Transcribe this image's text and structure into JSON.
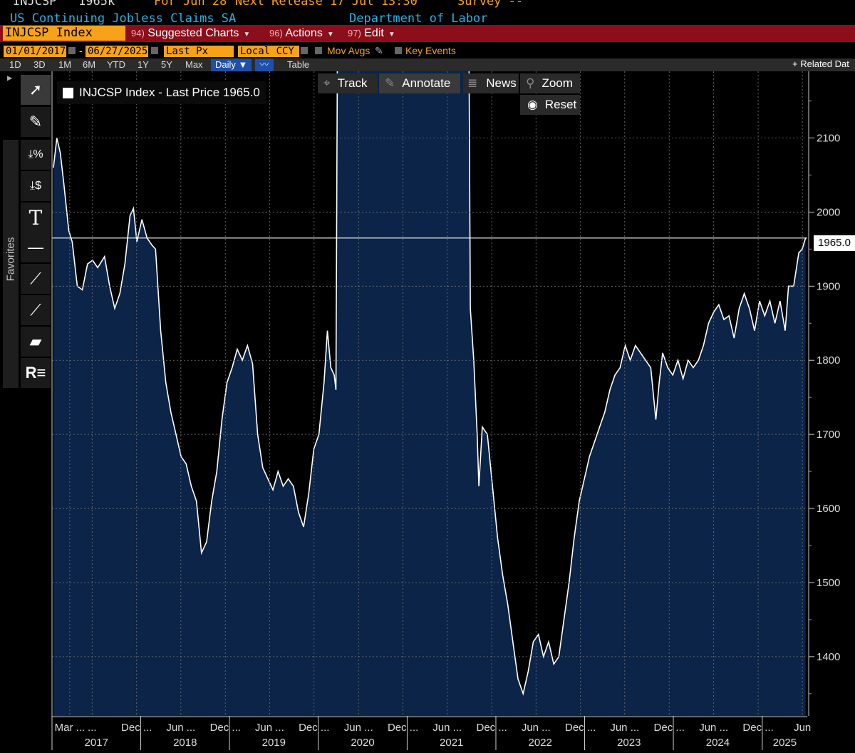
{
  "header": {
    "ticker": "INJCSP",
    "value": "1965k",
    "period": "For Jun 28",
    "next_release": "Next Release 17 Jul 13:30",
    "survey": "Survey --",
    "description": "US Continuing Jobless Claims SA",
    "source": "Department of Labor"
  },
  "menu": {
    "ticker_box": "INJCSP Index",
    "items": [
      {
        "num": "94)",
        "label": "Suggested Charts"
      },
      {
        "num": "96)",
        "label": "Actions"
      },
      {
        "num": "97)",
        "label": "Edit"
      }
    ]
  },
  "controls": {
    "start_date": "01/01/2017",
    "end_date": "06/27/2025",
    "field": "Last Px",
    "currency": "Local CCY",
    "mov_avgs": "Mov Avgs",
    "key_events": "Key Events"
  },
  "timeframes": [
    "1D",
    "3D",
    "1M",
    "6M",
    "YTD",
    "1Y",
    "5Y",
    "Max"
  ],
  "frequency": "Daily",
  "table_label": "Table",
  "related": "+ Related Dat",
  "overlay": {
    "track": "Track",
    "annotate": "Annotate",
    "news": "News",
    "zoom": "Zoom",
    "reset": "Reset"
  },
  "favorites_label": "Favorites",
  "legend": "INJCSP Index - Last Price 1965.0",
  "last_price_tag": "1965.0",
  "colors": {
    "line": "#ffffff",
    "area": "#0b2448",
    "accent": "#f8a21a",
    "menu_bar": "#8b0e1a"
  },
  "chart_data": {
    "type": "area",
    "title": "INJCSP Index - Last Price 1965.0",
    "xlabel": "",
    "ylabel": "",
    "ylim": [
      1320,
      2190
    ],
    "y_ticks": [
      1400,
      1500,
      1600,
      1700,
      1800,
      1900,
      2000,
      2100
    ],
    "last_value": 1965.0,
    "x_range": [
      "2017-01",
      "2025-06"
    ],
    "x_month_labels": [
      {
        "date": "2017-03",
        "label": "Mar ..."
      },
      {
        "date": "2017-06",
        "label": "..."
      },
      {
        "date": "2017-12",
        "label": "Dec ..."
      },
      {
        "date": "2018-06",
        "label": "Jun ..."
      },
      {
        "date": "2018-12",
        "label": "Dec ..."
      },
      {
        "date": "2019-06",
        "label": "Jun ..."
      },
      {
        "date": "2019-12",
        "label": "Dec ..."
      },
      {
        "date": "2020-06",
        "label": "Jun ..."
      },
      {
        "date": "2020-12",
        "label": "Dec ..."
      },
      {
        "date": "2021-06",
        "label": "Jun ..."
      },
      {
        "date": "2021-12",
        "label": "Dec ..."
      },
      {
        "date": "2022-06",
        "label": "Jun ..."
      },
      {
        "date": "2022-12",
        "label": "Dec ..."
      },
      {
        "date": "2023-06",
        "label": "Jun ..."
      },
      {
        "date": "2023-12",
        "label": "Dec ..."
      },
      {
        "date": "2024-06",
        "label": "Jun ..."
      },
      {
        "date": "2024-12",
        "label": "Dec ..."
      },
      {
        "date": "2025-06",
        "label": "Jun"
      }
    ],
    "x_year_labels": [
      "2017",
      "2018",
      "2019",
      "2020",
      "2021",
      "2022",
      "2023",
      "2024",
      "2025"
    ],
    "series": [
      {
        "name": "INJCSP Index",
        "points": [
          [
            "2017-01-07",
            2060
          ],
          [
            "2017-01-21",
            2100
          ],
          [
            "2017-02-04",
            2080
          ],
          [
            "2017-02-18",
            2040
          ],
          [
            "2017-03-11",
            1975
          ],
          [
            "2017-03-25",
            1960
          ],
          [
            "2017-04-15",
            1900
          ],
          [
            "2017-05-06",
            1895
          ],
          [
            "2017-05-27",
            1930
          ],
          [
            "2017-06-17",
            1935
          ],
          [
            "2017-07-08",
            1925
          ],
          [
            "2017-08-05",
            1940
          ],
          [
            "2017-08-26",
            1900
          ],
          [
            "2017-09-16",
            1870
          ],
          [
            "2017-10-07",
            1890
          ],
          [
            "2017-10-28",
            1930
          ],
          [
            "2017-11-18",
            1995
          ],
          [
            "2017-12-02",
            2005
          ],
          [
            "2017-12-16",
            1960
          ],
          [
            "2018-01-06",
            1990
          ],
          [
            "2018-01-27",
            1965
          ],
          [
            "2018-02-17",
            1955
          ],
          [
            "2018-03-03",
            1950
          ],
          [
            "2018-03-24",
            1840
          ],
          [
            "2018-04-14",
            1770
          ],
          [
            "2018-05-05",
            1730
          ],
          [
            "2018-05-26",
            1700
          ],
          [
            "2018-06-16",
            1670
          ],
          [
            "2018-07-07",
            1660
          ],
          [
            "2018-07-28",
            1630
          ],
          [
            "2018-08-18",
            1610
          ],
          [
            "2018-09-08",
            1540
          ],
          [
            "2018-09-29",
            1555
          ],
          [
            "2018-10-20",
            1610
          ],
          [
            "2018-11-10",
            1650
          ],
          [
            "2018-12-01",
            1720
          ],
          [
            "2018-12-22",
            1770
          ],
          [
            "2019-01-12",
            1790
          ],
          [
            "2019-02-02",
            1815
          ],
          [
            "2019-02-23",
            1800
          ],
          [
            "2019-03-16",
            1820
          ],
          [
            "2019-04-06",
            1795
          ],
          [
            "2019-04-27",
            1700
          ],
          [
            "2019-05-18",
            1655
          ],
          [
            "2019-06-08",
            1640
          ],
          [
            "2019-06-29",
            1625
          ],
          [
            "2019-07-20",
            1650
          ],
          [
            "2019-08-10",
            1630
          ],
          [
            "2019-08-31",
            1640
          ],
          [
            "2019-09-21",
            1630
          ],
          [
            "2019-10-12",
            1595
          ],
          [
            "2019-11-02",
            1575
          ],
          [
            "2019-11-23",
            1620
          ],
          [
            "2019-12-14",
            1680
          ],
          [
            "2020-01-04",
            1700
          ],
          [
            "2020-01-25",
            1770
          ],
          [
            "2020-02-08",
            1840
          ],
          [
            "2020-02-22",
            1790
          ],
          [
            "2020-03-07",
            1780
          ],
          [
            "2020-03-14",
            1760
          ],
          [
            "2020-03-21",
            2300
          ],
          [
            "2021-09-11",
            2300
          ],
          [
            "2021-09-18",
            1870
          ],
          [
            "2021-10-02",
            1800
          ],
          [
            "2021-10-16",
            1700
          ],
          [
            "2021-10-23",
            1630
          ],
          [
            "2021-11-06",
            1710
          ],
          [
            "2021-11-27",
            1700
          ],
          [
            "2021-12-18",
            1630
          ],
          [
            "2022-01-08",
            1560
          ],
          [
            "2022-01-29",
            1510
          ],
          [
            "2022-02-19",
            1470
          ],
          [
            "2022-03-12",
            1420
          ],
          [
            "2022-04-02",
            1370
          ],
          [
            "2022-04-23",
            1350
          ],
          [
            "2022-05-14",
            1380
          ],
          [
            "2022-06-04",
            1420
          ],
          [
            "2022-06-25",
            1430
          ],
          [
            "2022-07-16",
            1400
          ],
          [
            "2022-08-06",
            1420
          ],
          [
            "2022-08-27",
            1390
          ],
          [
            "2022-09-17",
            1400
          ],
          [
            "2022-10-08",
            1450
          ],
          [
            "2022-10-29",
            1500
          ],
          [
            "2022-11-19",
            1560
          ],
          [
            "2022-12-10",
            1610
          ],
          [
            "2022-12-31",
            1640
          ],
          [
            "2023-01-21",
            1670
          ],
          [
            "2023-02-11",
            1690
          ],
          [
            "2023-03-04",
            1710
          ],
          [
            "2023-03-25",
            1730
          ],
          [
            "2023-04-15",
            1760
          ],
          [
            "2023-05-06",
            1780
          ],
          [
            "2023-05-27",
            1790
          ],
          [
            "2023-06-17",
            1820
          ],
          [
            "2023-07-08",
            1800
          ],
          [
            "2023-07-29",
            1820
          ],
          [
            "2023-08-19",
            1810
          ],
          [
            "2023-09-09",
            1800
          ],
          [
            "2023-09-30",
            1790
          ],
          [
            "2023-10-21",
            1720
          ],
          [
            "2023-11-04",
            1770
          ],
          [
            "2023-11-18",
            1810
          ],
          [
            "2023-12-09",
            1790
          ],
          [
            "2023-12-30",
            1780
          ],
          [
            "2024-01-20",
            1800
          ],
          [
            "2024-02-10",
            1775
          ],
          [
            "2024-03-02",
            1800
          ],
          [
            "2024-03-23",
            1790
          ],
          [
            "2024-04-13",
            1800
          ],
          [
            "2024-05-04",
            1820
          ],
          [
            "2024-05-25",
            1850
          ],
          [
            "2024-06-15",
            1865
          ],
          [
            "2024-07-06",
            1875
          ],
          [
            "2024-07-27",
            1855
          ],
          [
            "2024-08-17",
            1860
          ],
          [
            "2024-09-07",
            1830
          ],
          [
            "2024-09-28",
            1870
          ],
          [
            "2024-10-19",
            1890
          ],
          [
            "2024-11-09",
            1870
          ],
          [
            "2024-11-30",
            1840
          ],
          [
            "2024-12-21",
            1880
          ],
          [
            "2025-01-11",
            1860
          ],
          [
            "2025-02-01",
            1880
          ],
          [
            "2025-02-22",
            1850
          ],
          [
            "2025-03-15",
            1880
          ],
          [
            "2025-04-05",
            1840
          ],
          [
            "2025-04-19",
            1900
          ],
          [
            "2025-05-10",
            1900
          ],
          [
            "2025-05-31",
            1945
          ],
          [
            "2025-06-14",
            1950
          ],
          [
            "2025-06-28",
            1965
          ]
        ]
      }
    ]
  }
}
